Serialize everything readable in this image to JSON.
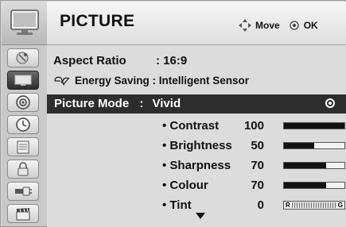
{
  "header": {
    "title": "PICTURE",
    "nav_move_label": "Move",
    "nav_ok_label": "OK"
  },
  "sidebar": {
    "items": [
      {
        "icon": "satellite-dish-icon"
      },
      {
        "icon": "tv-screen-icon",
        "active": true
      },
      {
        "icon": "speaker-icon"
      },
      {
        "icon": "clock-icon"
      },
      {
        "icon": "lock-calendar-icon"
      },
      {
        "icon": "padlock-icon"
      },
      {
        "icon": "usb-plug-icon"
      },
      {
        "icon": "clapperboard-icon"
      }
    ]
  },
  "rows": {
    "aspect_label": "Aspect Ratio",
    "aspect_value": ": 16:9",
    "energy_label": "Energy Saving : Intelligent Sensor",
    "mode_label": "Picture Mode",
    "mode_sep": ":",
    "mode_value": "Vivid"
  },
  "adjust": [
    {
      "label": "• Contrast",
      "value": "100",
      "level": 1.0
    },
    {
      "label": "• Brightness",
      "value": "50",
      "level": 0.5
    },
    {
      "label": "• Sharpness",
      "value": "70",
      "level": 0.7
    },
    {
      "label": "• Colour",
      "value": "70",
      "level": 0.7
    },
    {
      "label": "• Tint",
      "value": "0",
      "tint_left": "R",
      "tint_right": "G"
    }
  ]
}
